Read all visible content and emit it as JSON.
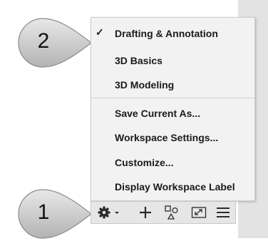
{
  "callouts": [
    {
      "number": "2"
    },
    {
      "number": "1"
    }
  ],
  "menu": {
    "items": [
      {
        "label": "Drafting & Annotation",
        "checked": true,
        "check_glyph": "✓"
      },
      {
        "label": "3D Basics",
        "checked": false
      },
      {
        "label": "3D Modeling",
        "checked": false
      },
      {
        "label": "Save Current As...",
        "checked": false
      },
      {
        "label": "Workspace Settings...",
        "checked": false
      },
      {
        "label": "Customize...",
        "checked": false
      },
      {
        "label": "Display Workspace Label",
        "checked": false
      }
    ]
  },
  "toolbar": {
    "buttons": [
      {
        "icon": "gear-icon"
      },
      {
        "icon": "chevron-down-icon"
      },
      {
        "icon": "plus-icon"
      },
      {
        "icon": "shapes-icon"
      },
      {
        "icon": "fullscreen-icon"
      },
      {
        "icon": "hamburger-menu-icon"
      }
    ]
  },
  "colors": {
    "menu_bg": "#f2f2f2",
    "callout_fill": "#c9c9c9",
    "toolbar_bg": "#e6e6e6",
    "icon": "#2b2b2b"
  }
}
